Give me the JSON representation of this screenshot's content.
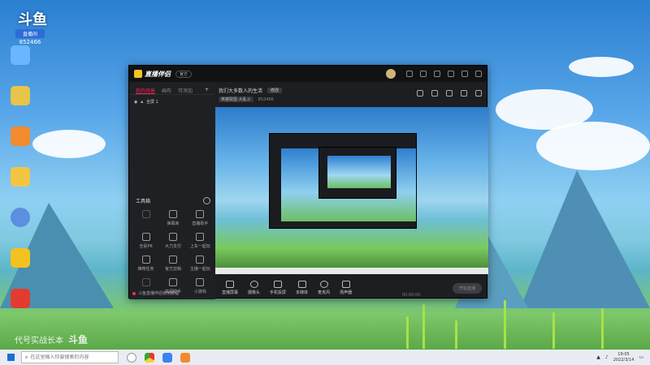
{
  "desktop": {
    "logo": "斗鱼",
    "room_label": "直播间",
    "room_number": "852466",
    "icons": [
      {
        "name": "tool-icon-1",
        "color": "#6bb6ff"
      },
      {
        "name": "app-icon-2",
        "color": "#e8c44a"
      },
      {
        "name": "game-icon-3",
        "color": "#f28a2e"
      },
      {
        "name": "app-icon-4",
        "color": "#f4c542"
      },
      {
        "name": "avatar-icon-5",
        "color": "#5c8fe0"
      },
      {
        "name": "app-icon-6",
        "color": "#f2c21e"
      },
      {
        "name": "app-icon-7",
        "color": "#e33b2f"
      },
      {
        "name": "app-icon-8",
        "color": "#ffd24a"
      }
    ]
  },
  "app": {
    "brand": "直播伴侣",
    "version_badge": "官方",
    "left_tabs": [
      "我的场景",
      "画布",
      "可添加"
    ],
    "left_tab_add": "+",
    "scene_item": "全屏 1",
    "tools_header": "工具箱",
    "tools": [
      {
        "label": "",
        "dim": true
      },
      {
        "label": "弹幕库",
        "dim": false
      },
      {
        "label": "直播助手",
        "dim": false
      },
      {
        "label": "全民PK",
        "dim": false
      },
      {
        "label": "大力支付",
        "dim": false
      },
      {
        "label": "上车一起玩",
        "dim": false
      },
      {
        "label": "推荐任务",
        "dim": false
      },
      {
        "label": "官方剪辑",
        "dim": false
      },
      {
        "label": "主播一起玩",
        "dim": false
      },
      {
        "label": "",
        "dim": true
      },
      {
        "label": "资源助手",
        "dim": false
      },
      {
        "label": "小游戏",
        "dim": false
      }
    ],
    "tip": "斗鱼直播伴侣使用教程",
    "live_title": "我们大多数人的生活",
    "edit_label": "修改",
    "category": "英雄联盟·大乱斗",
    "room_id_text": "852466",
    "controls": [
      "直播屏幕",
      "摄像头",
      "手机投屏",
      "多媒体",
      "麦克风",
      "扬声器"
    ],
    "start_button": "开始直播",
    "status_time": "00:00:00"
  },
  "taskbar": {
    "search_placeholder": "在这里输入你要搜索的内容",
    "time": "19:05",
    "date": "2022/3/14"
  },
  "watermark": {
    "text": "代号实战长本",
    "logo": "斗鱼"
  }
}
